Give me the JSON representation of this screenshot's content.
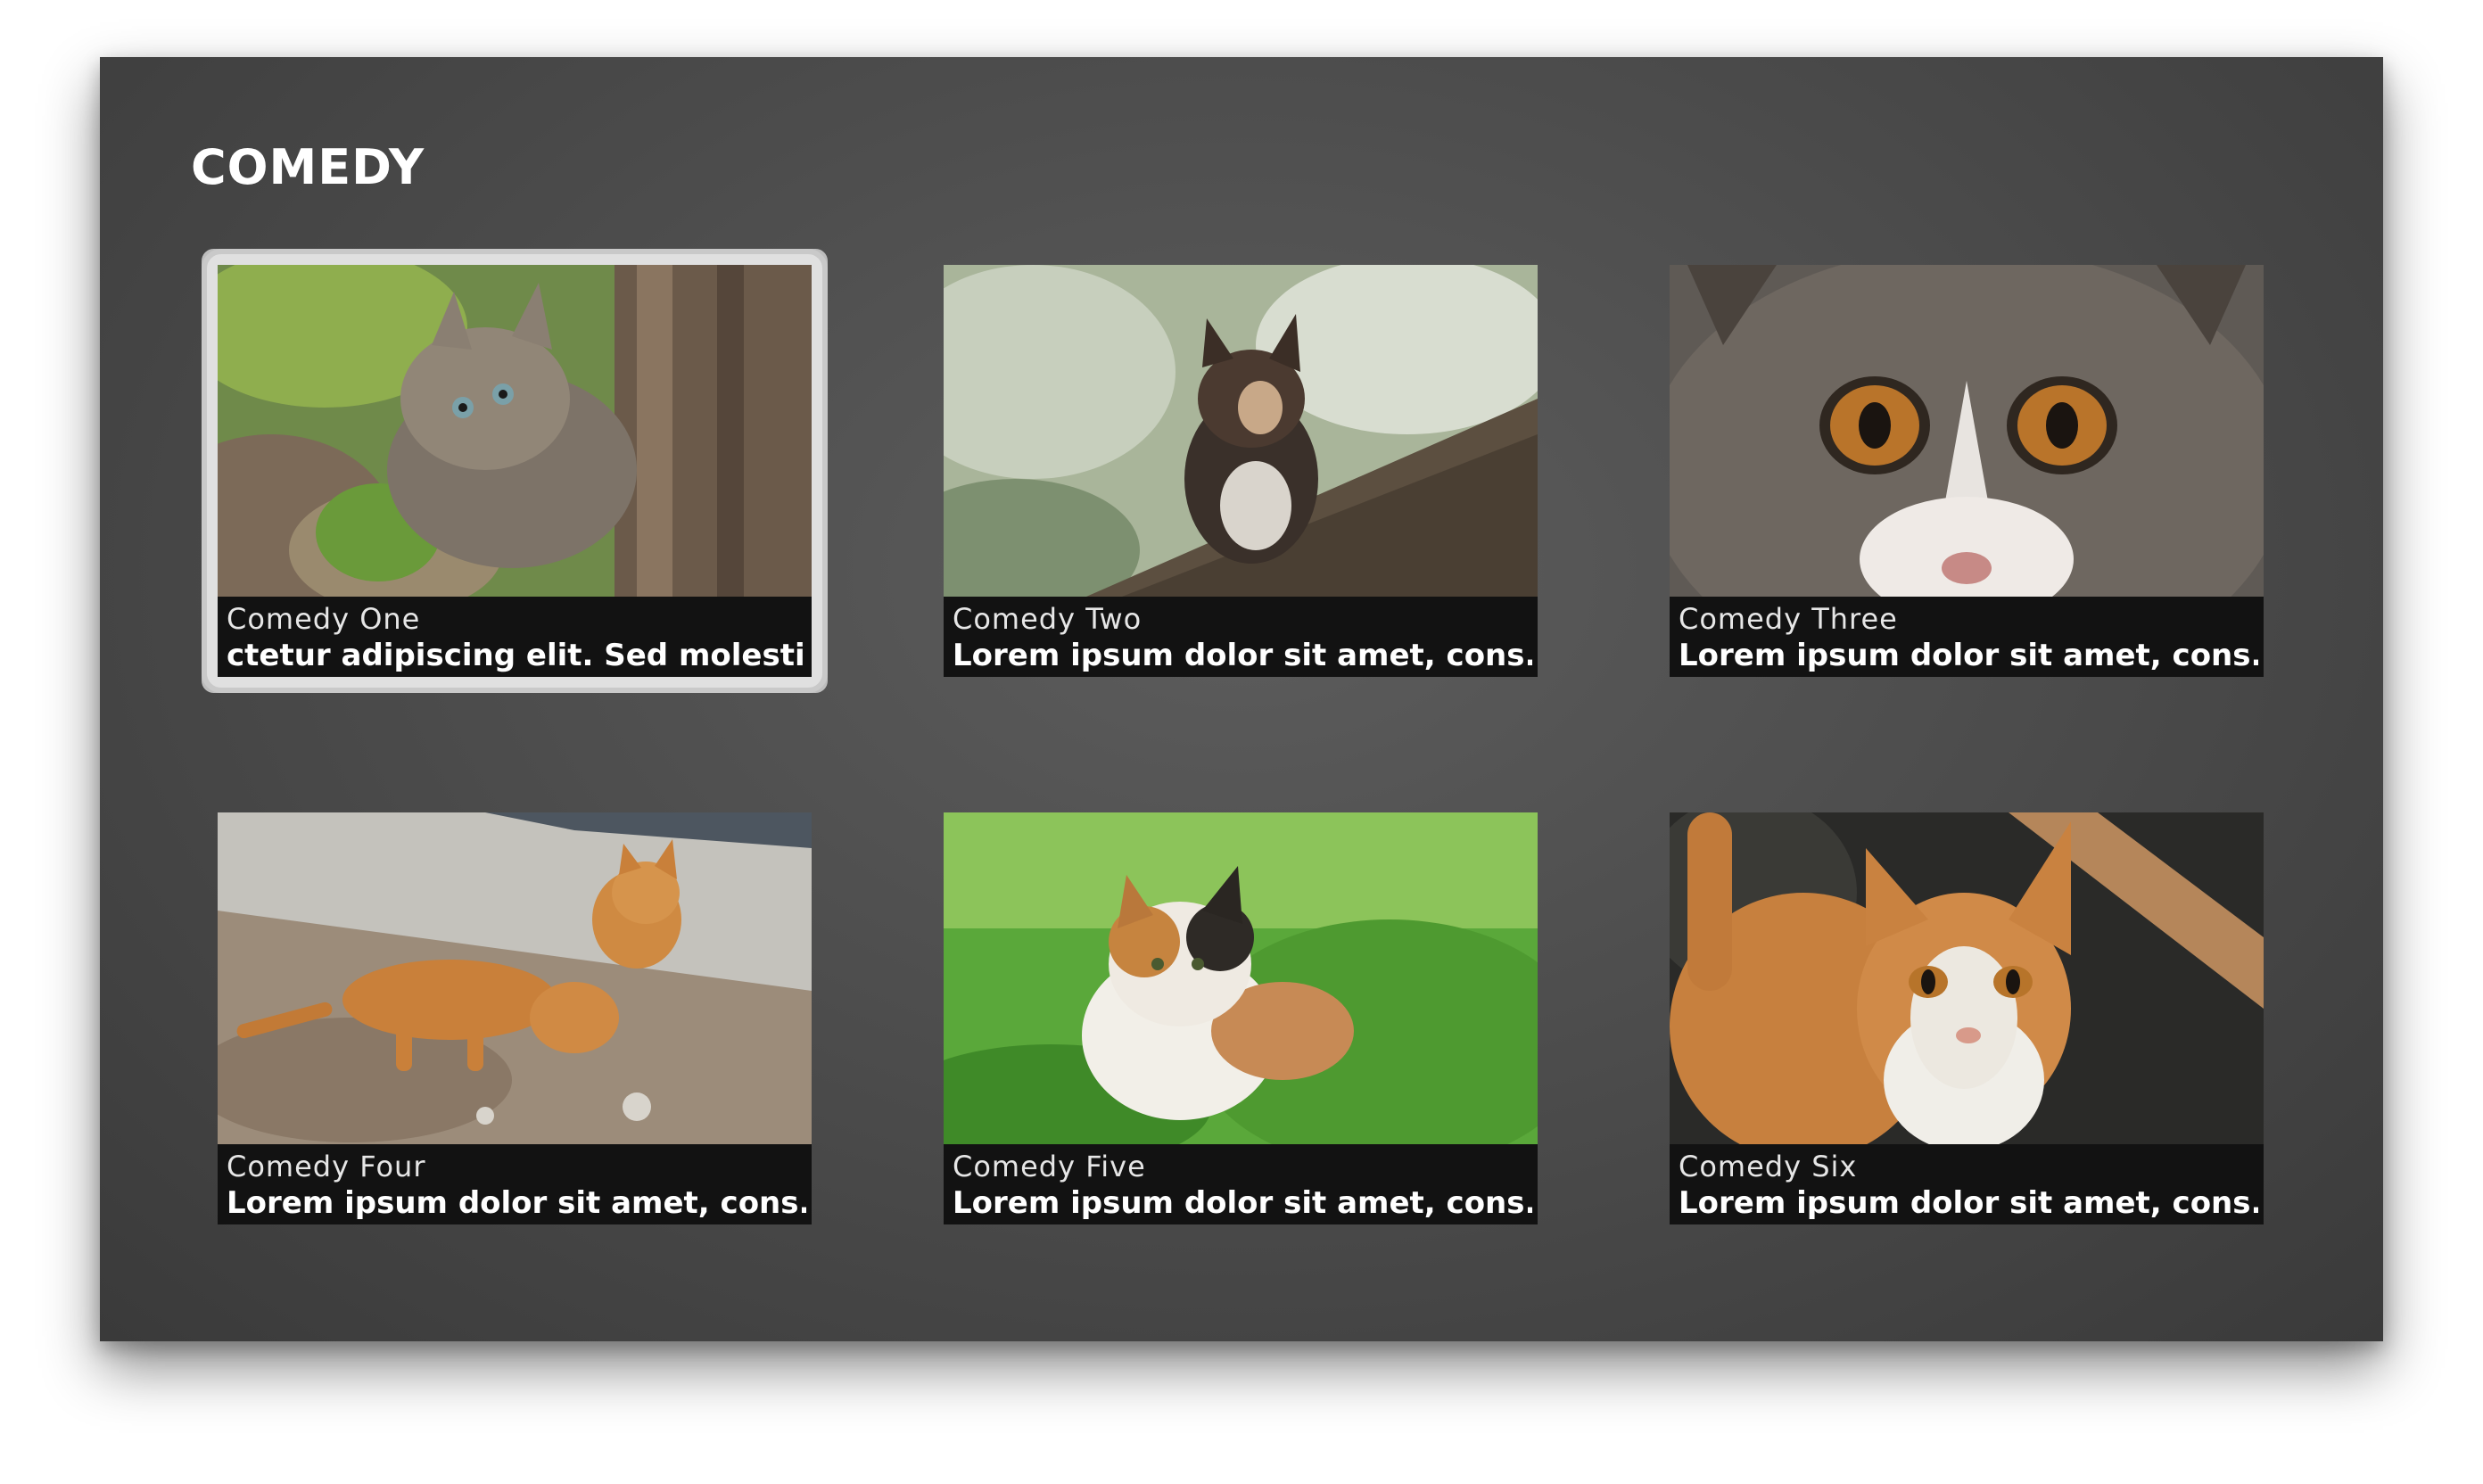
{
  "page": {
    "title": "COMEDY"
  },
  "tiles": [
    {
      "name": "Comedy One",
      "description": "ctetur adipiscing elit. Sed molestie v",
      "thumbnail_icon": "kitten-behind-tree-photo",
      "focused": true
    },
    {
      "name": "Comedy Two",
      "description": "Lorem ipsum dolor sit amet, cons...",
      "thumbnail_icon": "cat-on-roof-photo",
      "focused": false
    },
    {
      "name": "Comedy Three",
      "description": "Lorem ipsum dolor sit amet, cons...",
      "thumbnail_icon": "cat-face-closeup-photo",
      "focused": false
    },
    {
      "name": "Comedy Four",
      "description": "Lorem ipsum dolor sit amet, cons...",
      "thumbnail_icon": "orange-kittens-photo",
      "focused": false
    },
    {
      "name": "Comedy Five",
      "description": "Lorem ipsum dolor sit amet, cons...",
      "thumbnail_icon": "calico-cat-grass-photo",
      "focused": false
    },
    {
      "name": "Comedy Six",
      "description": "Lorem ipsum dolor sit amet, cons...",
      "thumbnail_icon": "orange-white-cat-photo",
      "focused": false
    }
  ],
  "colors": {
    "background": "#4a4a4a",
    "caption_bg": "#121212",
    "title_text": "#ffffff",
    "focus_border": "#c9c9c9"
  }
}
